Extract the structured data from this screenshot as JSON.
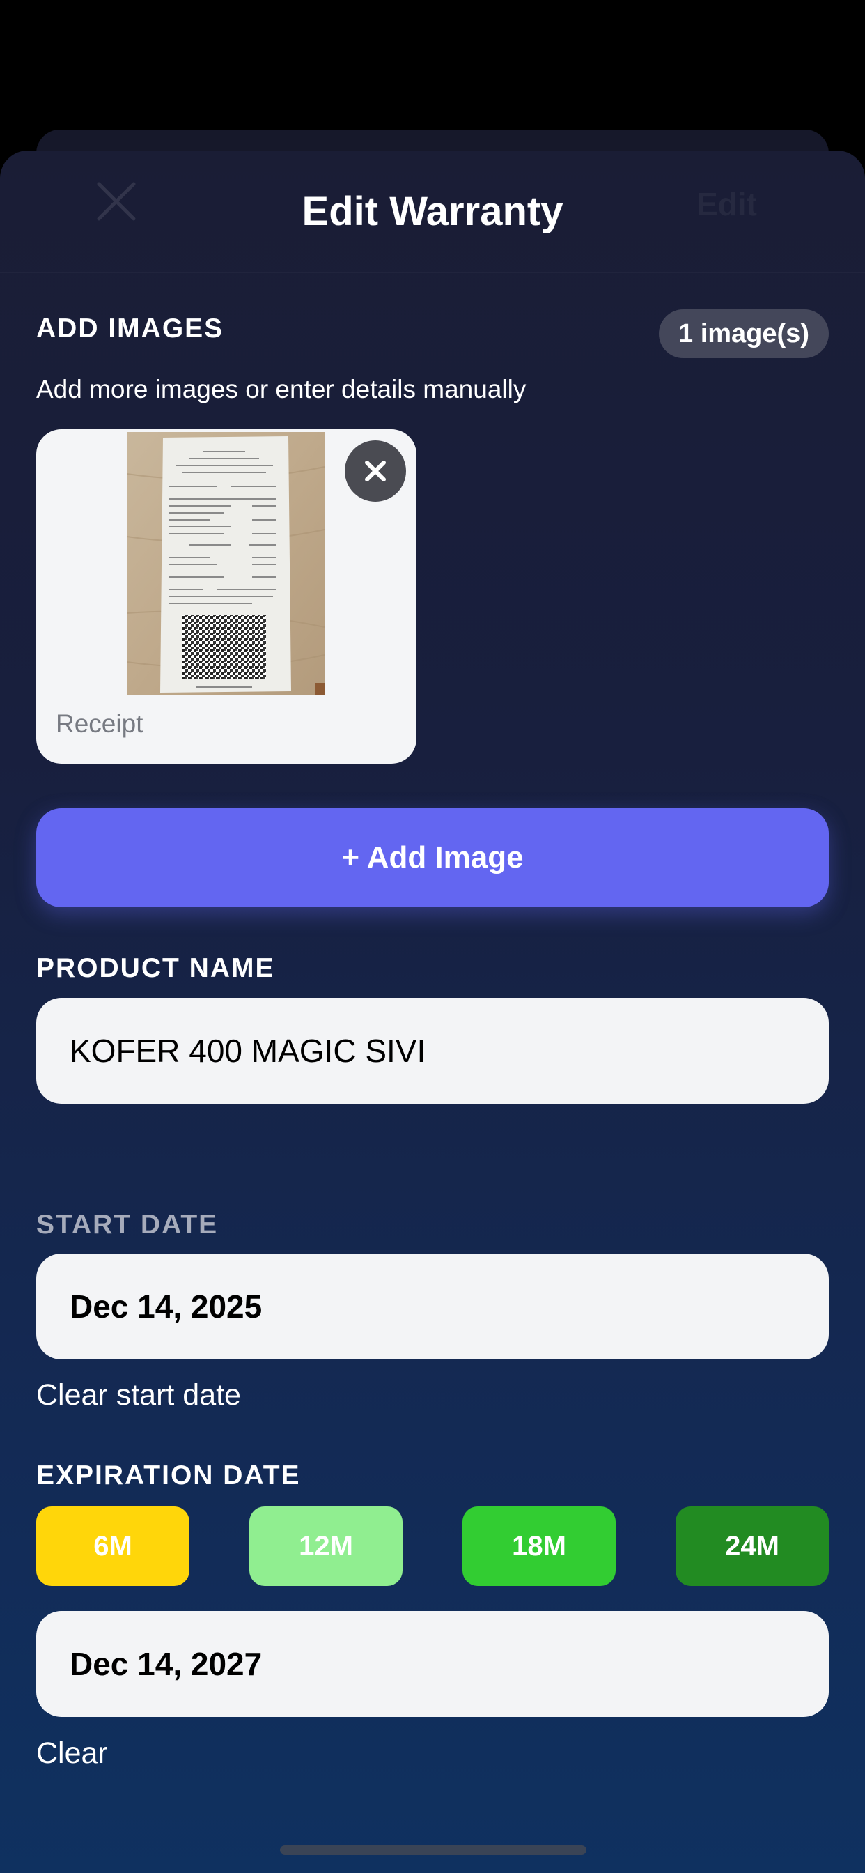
{
  "header": {
    "title": "Edit Warranty",
    "edit_label": "Edit",
    "close_icon": "close-icon"
  },
  "images_section": {
    "label": "ADD IMAGES",
    "count_badge": "1 image(s)",
    "helper": "Add more images or enter details manually",
    "images": [
      {
        "caption": "Receipt",
        "remove_icon": "close-icon"
      }
    ],
    "add_button": "+ Add Image"
  },
  "product": {
    "label": "PRODUCT NAME",
    "value": "KOFER 400 MAGIC SIVI"
  },
  "start_date": {
    "label": "START DATE",
    "value": "Dec 14, 2025",
    "clear_label": "Clear start date"
  },
  "expiration": {
    "label": "EXPIRATION DATE",
    "presets": [
      {
        "label": "6M",
        "color": "#ffd60a"
      },
      {
        "label": "12M",
        "color": "#90ee90"
      },
      {
        "label": "18M",
        "color": "#32cd32"
      },
      {
        "label": "24M",
        "color": "#228b22"
      }
    ],
    "value": "Dec 14, 2027",
    "clear_label": "Clear"
  },
  "colors": {
    "accent": "#6366f1",
    "field_bg": "#f3f4f6",
    "badge_bg": "#44475a"
  }
}
